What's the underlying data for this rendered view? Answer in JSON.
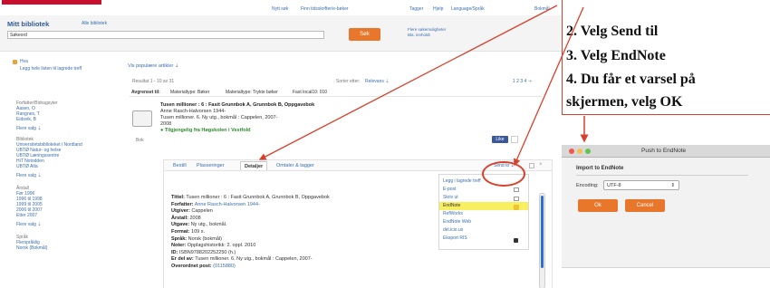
{
  "top_nav": {
    "items": [
      "Nytt søk",
      "Finn tidsskrifter/e-bøker",
      "Tagger",
      "Hjelp",
      "Language/Språk",
      "Bokmål"
    ],
    "library_tab": "Mitt bibliotek",
    "alt_tab": "Alle bibliotek",
    "search_value": "Søkeord",
    "search_button": "Søk",
    "advanced_search": [
      "Flere søkemuligheter",
      "Bla. innholdt"
    ]
  },
  "left_sidebar": {
    "saved_label": "Hva",
    "saved_items": [
      "Legg hele listen til lagrede treff"
    ],
    "facet_author_title": "Forfatter/Bidragsyter",
    "facet_author_items": [
      "Aasen, O",
      "Rangnes, T",
      "Eidsvik, B"
    ],
    "facet_author_more": "Flere valg ⇣",
    "facet_library_title": "Bibliotek",
    "facet_library_items": [
      "Universitetsbiblioteket i Nordland",
      "UBTØ Natur- og helse",
      "UBTØ Læringssentre",
      "HiT Notodden",
      "UBTØ Alta"
    ],
    "facet_library_more": "Flere valg ⇣",
    "facet_year_title": "Årstall",
    "facet_year_items": [
      "Før 1996",
      "1996 til 1998",
      "1999 til 2005",
      "2006 til 2007",
      "Etter 2007"
    ],
    "facet_year_more": "Flere valg ⇣",
    "facet_lang_title": "Språk",
    "facet_lang_items": [
      "Flerspråklig",
      "Norsk (Bokmål)"
    ]
  },
  "results": {
    "popular_link": "Vis populære artikler ⇣",
    "result_count": "Resultat 1 - 10 av 31",
    "sort_label": "Sorter etter:",
    "sort_value": "Relevans ⇣",
    "paging": "1 2 3 4 ⇢",
    "refined_label": "Avgrenset til:",
    "refined_items": [
      "Materialtype: Bøker",
      "Materialtype: Trykte bøker",
      "Fast local10: 010"
    ],
    "record": {
      "title": "Tusen millioner : 6 : Fasit Grunnbok A, Grunnbok B, Oppgavebok",
      "author": "Anne Rasch-Halvorsen 1944-",
      "edition": "Tusen millioner. 6. Ny utg., bokmål : Cappelen, 2007-",
      "year": "2008",
      "availability": "● Tilgjengelig fra Høgskolen i Vestfold",
      "format": "Bok",
      "like_button": "Like"
    },
    "tabs": [
      "Bestill",
      "Plasseringer",
      "Detaljer",
      "Omtaler & tagger"
    ],
    "send_to_button": "Send to ⇣",
    "details": [
      {
        "label": "Tittel:",
        "value": "Tusen millioner : 6 : Fasit Grunnbok A, Grunnbok B, Oppgavebok"
      },
      {
        "label": "Forfatter:",
        "value": "Anne Rasch-Halvorsen 1944-"
      },
      {
        "label": "Utgiver:",
        "value": "Cappelen"
      },
      {
        "label": "Årstall:",
        "value": "2008"
      },
      {
        "label": "Utgave:",
        "value": "Ny utg., bokmål."
      },
      {
        "label": "Format:",
        "value": "109 s."
      },
      {
        "label": "Språk:",
        "value": "Norsk (bokmål)"
      },
      {
        "label": "Noter:",
        "value": "Opplagshistorikk: 2. oppl. 2010"
      },
      {
        "label": "ID:",
        "value": "ISBN9788202252250 (h.)"
      },
      {
        "label": "Er del av:",
        "value": "Tusen millioner. 6. Ny utg., bokmål : Cappelen, 2007-"
      },
      {
        "label": "Overordnet post:",
        "value": "(0115880)"
      }
    ],
    "send_menu": [
      "Legg i lagrede treff",
      "E-post",
      "Skriv ut",
      "EndNote",
      "RefWorks",
      "EndNote Web",
      "del.icio.us",
      "Eksport RIS"
    ]
  },
  "instructions": {
    "items": [
      "2.  Velg Send til",
      "3.  Velg EndNote",
      "4.  Du får et varsel på",
      "     skjermen, velg OK"
    ]
  },
  "dialog": {
    "title": "Push to EndNote",
    "section": "Import to EndNote",
    "encoding_label": "Encoding:",
    "encoding_value": "UTF-8",
    "ok_button": "Ok",
    "cancel_button": "Cancel"
  },
  "colors": {
    "accent_orange": "#e8762b",
    "arrow_red": "#d9402b",
    "highlight_yellow": "#f7ee60",
    "link_blue": "#3a6fb0",
    "brand_red": "#c8102e"
  }
}
